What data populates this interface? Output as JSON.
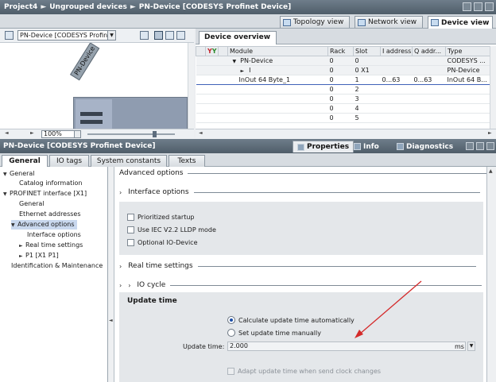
{
  "breadcrumb": [
    "Project4",
    "Ungrouped devices",
    "PN-Device [CODESYS Profinet Device]"
  ],
  "view_tabs": [
    "Topology view",
    "Network view",
    "Device view"
  ],
  "device_select": "PN-Device [CODESYS Profinet",
  "rack_label": "PN-Device",
  "zoom": "100%",
  "overview": {
    "tab": "Device overview",
    "columns": [
      "Module",
      "Rack",
      "Slot",
      "I address",
      "Q addr...",
      "Type"
    ],
    "rows": [
      {
        "module": "PN-Device",
        "rack": "0",
        "slot": "0",
        "iaddr": "",
        "qaddr": "",
        "type": "CODESYS ..."
      },
      {
        "module": "I",
        "rack": "0",
        "slot": "0 X1",
        "iaddr": "",
        "qaddr": "",
        "type": "PN-Device"
      },
      {
        "module": "InOut 64 Byte_1",
        "rack": "0",
        "slot": "1",
        "iaddr": "0...63",
        "qaddr": "0...63",
        "type": "InOut 64 B..."
      },
      {
        "module": "",
        "rack": "0",
        "slot": "2",
        "iaddr": "",
        "qaddr": "",
        "type": ""
      },
      {
        "module": "",
        "rack": "0",
        "slot": "3",
        "iaddr": "",
        "qaddr": "",
        "type": ""
      },
      {
        "module": "",
        "rack": "0",
        "slot": "4",
        "iaddr": "",
        "qaddr": "",
        "type": ""
      },
      {
        "module": "",
        "rack": "0",
        "slot": "5",
        "iaddr": "",
        "qaddr": "",
        "type": ""
      }
    ]
  },
  "inspector": {
    "title": "PN-Device [CODESYS Profinet Device]",
    "tabs": [
      "Properties",
      "Info",
      "Diagnostics"
    ],
    "subtabs": [
      "General",
      "IO tags",
      "System constants",
      "Texts"
    ]
  },
  "tree": [
    {
      "label": "General",
      "indent": 0,
      "toggle": "open"
    },
    {
      "label": "Catalog information",
      "indent": 1,
      "toggle": ""
    },
    {
      "label": "PROFINET interface [X1]",
      "indent": 0,
      "toggle": "open"
    },
    {
      "label": "General",
      "indent": 1,
      "toggle": ""
    },
    {
      "label": "Ethernet addresses",
      "indent": 1,
      "toggle": ""
    },
    {
      "label": "Advanced options",
      "indent": 1,
      "toggle": "open"
    },
    {
      "label": "Interface options",
      "indent": 2,
      "toggle": ""
    },
    {
      "label": "Real time settings",
      "indent": 2,
      "toggle": "closed"
    },
    {
      "label": "P1 [X1 P1]",
      "indent": 2,
      "toggle": "closed"
    },
    {
      "label": "Identification & Maintenance",
      "indent": 0,
      "toggle": ""
    }
  ],
  "content": {
    "advanced_header": "Advanced options",
    "interface_header": "Interface options",
    "checkboxes": [
      "Prioritized startup",
      "Use IEC V2.2 LLDP mode",
      "Optional IO-Device"
    ],
    "realtime_header": "Real time settings",
    "iocycle_header": "IO cycle",
    "update_time_header": "Update time",
    "radio_auto": "Calculate update time automatically",
    "radio_manual": "Set update time manually",
    "update_time_label": "Update time:",
    "update_time_value": "2.000",
    "update_time_unit": "ms",
    "adapt_label": "Adapt update time when send clock changes"
  },
  "colors": {
    "accent": "#1d4fa8",
    "annotation_arrow": "#d42a2a"
  }
}
